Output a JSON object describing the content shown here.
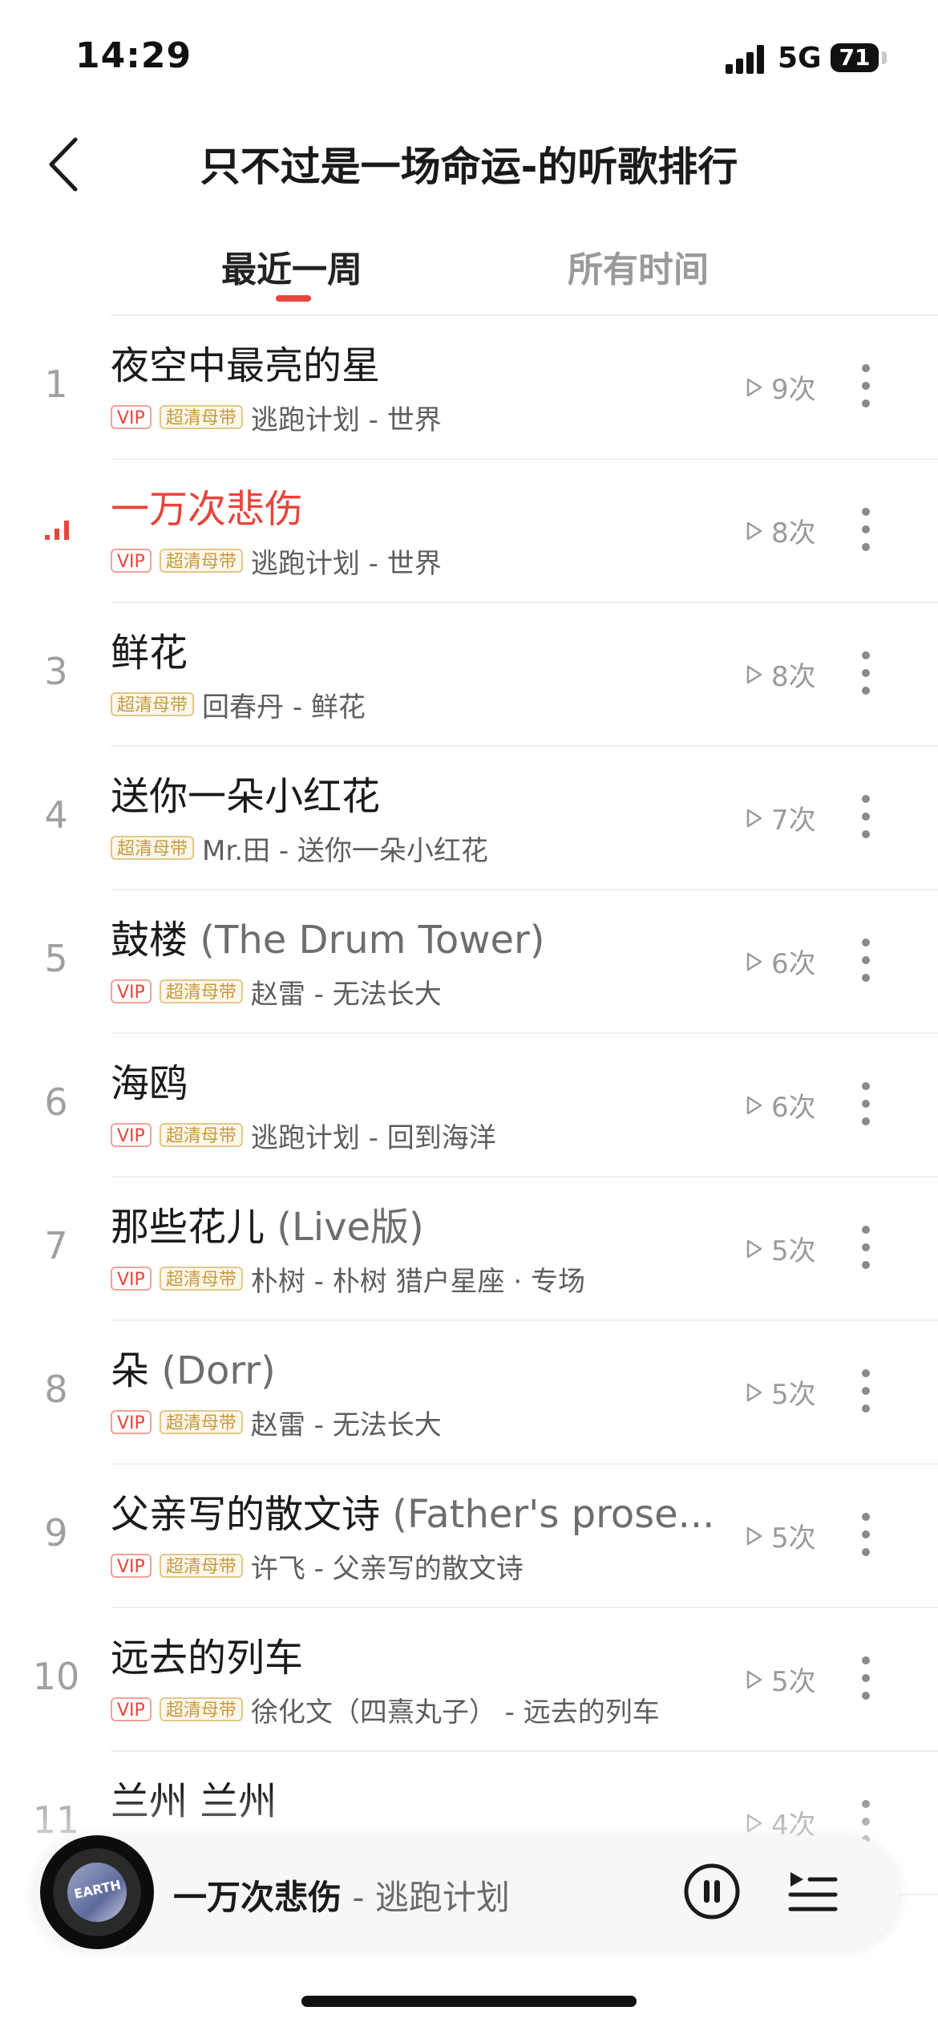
{
  "status_bar": {
    "time": "14:29",
    "network": "5G",
    "battery": "71"
  },
  "header": {
    "title": "只不过是一场命运-的听歌排行"
  },
  "tabs": [
    {
      "label": "最近一周",
      "active": true
    },
    {
      "label": "所有时间",
      "active": false
    }
  ],
  "songs": [
    {
      "rank": "1",
      "title": "夜空中最亮的星",
      "subtitle": "",
      "vip": "VIP",
      "hq": "超清母带",
      "artist": "逃跑计划 - 世界",
      "plays": "9次",
      "playing": false
    },
    {
      "rank": "",
      "title": "一万次悲伤",
      "subtitle": "",
      "vip": "VIP",
      "hq": "超清母带",
      "artist": "逃跑计划 - 世界",
      "plays": "8次",
      "playing": true
    },
    {
      "rank": "3",
      "title": "鲜花",
      "subtitle": "",
      "vip": "",
      "hq": "超清母带",
      "artist": "回春丹 - 鲜花",
      "plays": "8次",
      "playing": false
    },
    {
      "rank": "4",
      "title": "送你一朵小红花",
      "subtitle": "",
      "vip": "",
      "hq": "超清母带",
      "artist": "Mr.田 - 送你一朵小红花",
      "plays": "7次",
      "playing": false
    },
    {
      "rank": "5",
      "title": "鼓楼",
      "subtitle": "(The Drum Tower)",
      "vip": "VIP",
      "hq": "超清母带",
      "artist": "赵雷 - 无法长大",
      "plays": "6次",
      "playing": false
    },
    {
      "rank": "6",
      "title": "海鸥",
      "subtitle": "",
      "vip": "VIP",
      "hq": "超清母带",
      "artist": "逃跑计划 - 回到海洋",
      "plays": "6次",
      "playing": false
    },
    {
      "rank": "7",
      "title": "那些花儿",
      "subtitle": "(Live版)",
      "vip": "VIP",
      "hq": "超清母带",
      "artist": "朴树 - 朴树 猎户星座 · 专场",
      "plays": "5次",
      "playing": false
    },
    {
      "rank": "8",
      "title": "朵",
      "subtitle": "(Dorr)",
      "vip": "VIP",
      "hq": "超清母带",
      "artist": "赵雷 - 无法长大",
      "plays": "5次",
      "playing": false
    },
    {
      "rank": "9",
      "title": "父亲写的散文诗",
      "subtitle": "(Father's prose...",
      "vip": "VIP",
      "hq": "超清母带",
      "artist": "许飞 - 父亲写的散文诗",
      "plays": "5次",
      "playing": false
    },
    {
      "rank": "10",
      "title": "远去的列车",
      "subtitle": "",
      "vip": "VIP",
      "hq": "超清母带",
      "artist": "徐化文（四熹丸子） - 远去的列车",
      "plays": "5次",
      "playing": false
    },
    {
      "rank": "11",
      "title": "兰州 兰州",
      "subtitle": "",
      "vip": "",
      "hq": "",
      "artist": "",
      "plays": "4次",
      "playing": false
    }
  ],
  "mini_player": {
    "title": "一万次悲伤",
    "artist": " - 逃跑计划",
    "cover_text": "EARTH"
  },
  "colors": {
    "accent": "#e8453c",
    "hq_badge": "#c79a40",
    "muted": "#9b9b9b"
  },
  "icons": {
    "back": "chevron-left-icon",
    "play": "play-triangle-icon",
    "more": "vertical-dots-icon",
    "pause": "pause-icon",
    "playlist": "playlist-icon",
    "playing": "bars-icon"
  }
}
